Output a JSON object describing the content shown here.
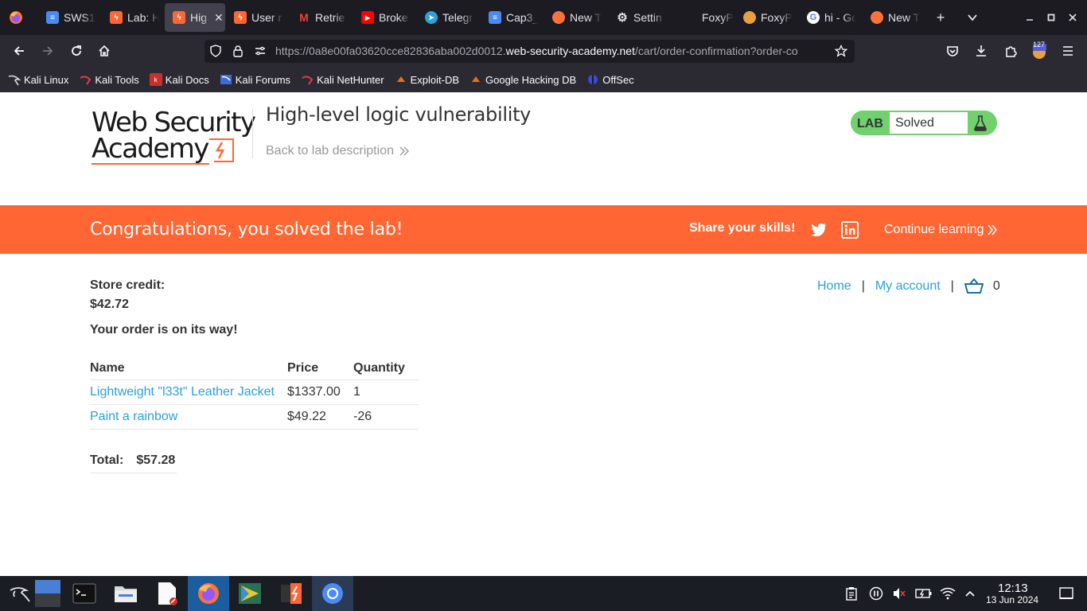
{
  "browser": {
    "tabs": [
      {
        "label": "SWS1",
        "icon": "doc-icon",
        "color": "#4a8af4"
      },
      {
        "label": "Lab: H",
        "icon": "portswigger-icon",
        "color": "#ff6633"
      },
      {
        "label": "Hig",
        "icon": "portswigger-icon",
        "color": "#ff6633",
        "active": true
      },
      {
        "label": "User r",
        "icon": "portswigger-icon",
        "color": "#ff6633"
      },
      {
        "label": "Retrie",
        "icon": "gmail-icon",
        "color": "#ea4335"
      },
      {
        "label": "Broke",
        "icon": "youtube-icon",
        "color": "#ff0000"
      },
      {
        "label": "Telegr",
        "icon": "telegram-icon",
        "color": "#2aa3df"
      },
      {
        "label": "Cap3_",
        "icon": "doc-icon",
        "color": "#4a8af4"
      },
      {
        "label": "New T",
        "icon": "firefox-icon",
        "color": "#ff7139"
      },
      {
        "label": "Settin",
        "icon": "gear-icon",
        "color": "#e0e0e6"
      },
      {
        "label": "FoxyP",
        "icon": "blank-icon",
        "color": "#1c1b22"
      },
      {
        "label": "FoxyP",
        "icon": "foxyproxy-icon",
        "color": "#e8a040"
      },
      {
        "label": "hi - Go",
        "icon": "google-icon",
        "color": "#ffffff"
      },
      {
        "label": "New T",
        "icon": "firefox-icon",
        "color": "#ff7139"
      }
    ],
    "url_host_prefix": "https://0a8e00fa03620cce82836aba002d0012.",
    "url_domain": "web-security-academy.net",
    "url_path": "/cart/order-confirmation?order-co",
    "extension_badge": "127",
    "bookmarks": [
      "Kali Linux",
      "Kali Tools",
      "Kali Docs",
      "Kali Forums",
      "Kali NetHunter",
      "Exploit-DB",
      "Google Hacking DB",
      "OffSec"
    ]
  },
  "header": {
    "logo_line1": "Web Security",
    "logo_line2": "Academy",
    "lab_title": "High-level logic vulnerability",
    "back_link": "Back to lab description",
    "badge_lab": "LAB",
    "badge_status": "Solved"
  },
  "banner": {
    "message": "Congratulations, you solved the lab!",
    "share": "Share your skills!",
    "continue": "Continue learning",
    "color": "#ff6633"
  },
  "account": {
    "credit_label": "Store credit:",
    "credit_value": "$42.72",
    "order_message": "Your order is on its way!"
  },
  "nav": {
    "home": "Home",
    "separator": "|",
    "my_account": "My account",
    "cart_count": "0"
  },
  "order": {
    "columns": [
      "Name",
      "Price",
      "Quantity"
    ],
    "rows": [
      {
        "name": "Lightweight \"l33t\" Leather Jacket",
        "price": "$1337.00",
        "quantity": "1"
      },
      {
        "name": "Paint a rainbow",
        "price": "$49.22",
        "quantity": "-26"
      }
    ],
    "total_label": "Total:",
    "total_value": "$57.28"
  },
  "taskbar": {
    "time": "12:13",
    "date": "13 Jun 2024"
  }
}
